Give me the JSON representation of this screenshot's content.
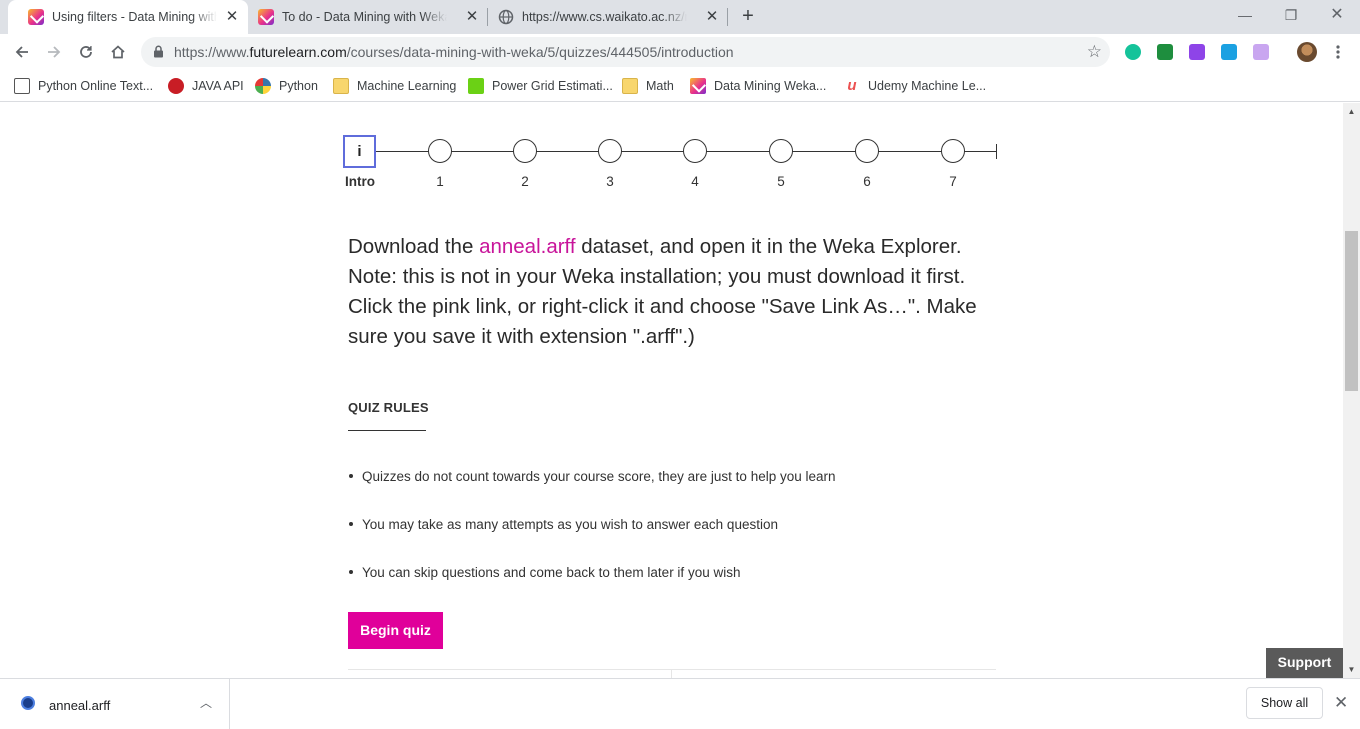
{
  "tabs": [
    {
      "title": "Using filters - Data Mining with W",
      "close": "✕"
    },
    {
      "title": "To do - Data Mining with Weka -",
      "close": "✕"
    },
    {
      "title": "https://www.cs.waikato.ac.nz/ml/",
      "close": "✕"
    }
  ],
  "window": {
    "new_tab": "+",
    "minimize": "—",
    "restore": "❐",
    "close": "✕"
  },
  "address": {
    "scheme": "https://www.",
    "host": "futurelearn.com",
    "path": "/courses/data-mining-with-weka/5/quizzes/444505/introduction",
    "star": "☆"
  },
  "bookmarks": [
    {
      "label": "Python Online Text...",
      "icon": "document-icon"
    },
    {
      "label": "JAVA API",
      "icon": "oracle-icon"
    },
    {
      "label": "Python",
      "icon": "python-icon"
    },
    {
      "label": "Machine Learning",
      "icon": "folder-icon"
    },
    {
      "label": "Power Grid Estimati...",
      "icon": "smiley-icon"
    },
    {
      "label": "Math",
      "icon": "folder-icon"
    },
    {
      "label": "Data Mining Weka...",
      "icon": "futurelearn-icon"
    },
    {
      "label": "Udemy Machine Le...",
      "icon": "udemy-icon"
    }
  ],
  "steps": {
    "intro_symbol": "i",
    "intro_label": "Intro",
    "labels": [
      "1",
      "2",
      "3",
      "4",
      "5",
      "6",
      "7"
    ]
  },
  "content": {
    "desc_before": "Download the ",
    "desc_link": "anneal.arff",
    "desc_after": " dataset, and open it in the Weka Explorer. Note: this is not in your Weka installation; you must download it first. Click the pink link, or right-click it and choose \"Save Link As…\". Make sure you save it with extension \".arff\".)",
    "rules_heading": "QUIZ RULES",
    "rules": [
      "Quizzes do not count towards your course score, they are just to help you learn",
      "You may take as many attempts as you wish to answer each question",
      "You can skip questions and come back to them later if you wish"
    ],
    "begin_button": "Begin quiz",
    "support_button": "Support"
  },
  "downloads": {
    "file": "anneal.arff",
    "chevron": "︿",
    "show_all": "Show all",
    "close": "✕"
  },
  "colors": {
    "accent_pink": "#e0009a",
    "link_pink": "#c8149a",
    "intro_border": "#5f6cdb"
  }
}
